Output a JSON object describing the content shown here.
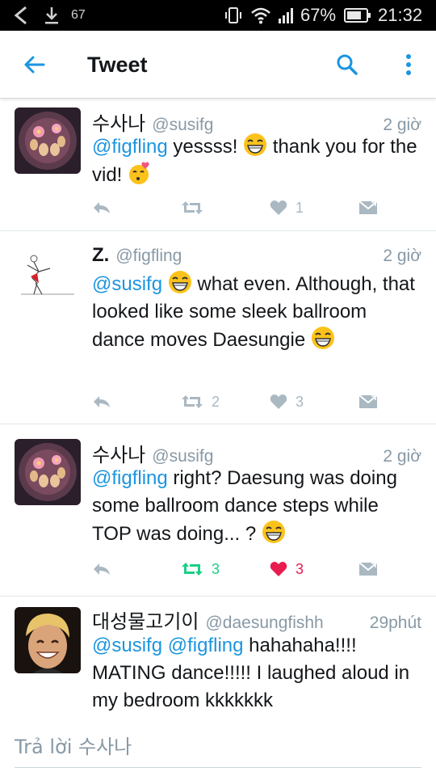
{
  "status_bar": {
    "notification_count": "67",
    "battery_percent": "67%",
    "time": "21:32"
  },
  "header": {
    "title": "Tweet"
  },
  "tweets": [
    {
      "name": "수사나",
      "handle": "@susifg",
      "time": "2 giờ",
      "text": [
        {
          "mention": "@figfling"
        },
        {
          "text": " yessss! "
        },
        {
          "emoji": "grin"
        },
        {
          "text": " thank you for the vid! "
        },
        {
          "emoji": "kiss"
        }
      ],
      "retweets": "",
      "likes": "1",
      "retweeted": false,
      "liked": false
    },
    {
      "name": "Z.",
      "handle": "@figfling",
      "time": "2 giờ",
      "text": [
        {
          "mention": "@susifg"
        },
        {
          "text": " "
        },
        {
          "emoji": "grin"
        },
        {
          "text": " what even. Although, that looked like some sleek ballroom dance moves Daesungie "
        },
        {
          "emoji": "grin"
        }
      ],
      "retweets": "2",
      "likes": "3",
      "retweeted": false,
      "liked": false
    },
    {
      "name": "수사나",
      "handle": "@susifg",
      "time": "2 giờ",
      "text": [
        {
          "mention": "@figfling"
        },
        {
          "text": " right? Daesung was doing some ballroom dance steps while TOP was doing...  ? "
        },
        {
          "emoji": "grin"
        }
      ],
      "retweets": "3",
      "likes": "3",
      "retweeted": true,
      "liked": true
    },
    {
      "name": "대성물고기이",
      "handle": "@daesungfishh",
      "time": "29phút",
      "text": [
        {
          "mention": "@susifg"
        },
        {
          "text": " "
        },
        {
          "mention": "@figfling"
        },
        {
          "text": " hahahaha!!!! MATING dance!!!!! I laughed aloud in my bedroom kkkkkkk"
        }
      ],
      "retweets": "",
      "likes": "",
      "retweeted": false,
      "liked": false
    }
  ],
  "reply_bar": {
    "placeholder": "Trả lời 수사나"
  },
  "colors": {
    "accent": "#1b95e0",
    "retweet_green": "#19cf86",
    "like_red": "#e81c4f",
    "muted": "#aab8c2"
  }
}
